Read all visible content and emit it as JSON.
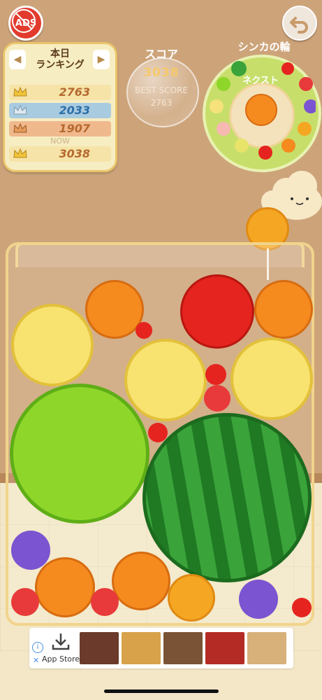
{
  "header": {
    "ads_label": "ADS",
    "back_icon": "undo-arrow-icon"
  },
  "ranking": {
    "title_line1": "本日",
    "title_line2": "ランキング",
    "rows": [
      {
        "rank_icon": "gold-crown-icon",
        "value": "2763"
      },
      {
        "rank_icon": "silver-crown-icon",
        "value": "2033"
      },
      {
        "rank_icon": "bronze-crown-icon",
        "value": "1907"
      }
    ],
    "now_label": "NOW",
    "now_value": "3038"
  },
  "score": {
    "label": "スコア",
    "value": "3038",
    "best_label": "BEST SCORE",
    "best_value": "2763"
  },
  "evolution_ring": {
    "title": "シンカの輪",
    "next_label": "ネクスト",
    "next_fruit": "orange"
  },
  "ad": {
    "info_icon": "info-icon",
    "close_icon": "close-icon",
    "store_label": "App Store"
  },
  "colors": {
    "wall": "#cda47a",
    "jar_border": "#f1d48c",
    "watermelon": "#3aa33a",
    "melon": "#8fd62b",
    "orange": "#f58a1f",
    "pear": "#f8e270",
    "apple": "#e5241f",
    "grape": "#7b54d1",
    "strawberry": "#e83a3a"
  }
}
